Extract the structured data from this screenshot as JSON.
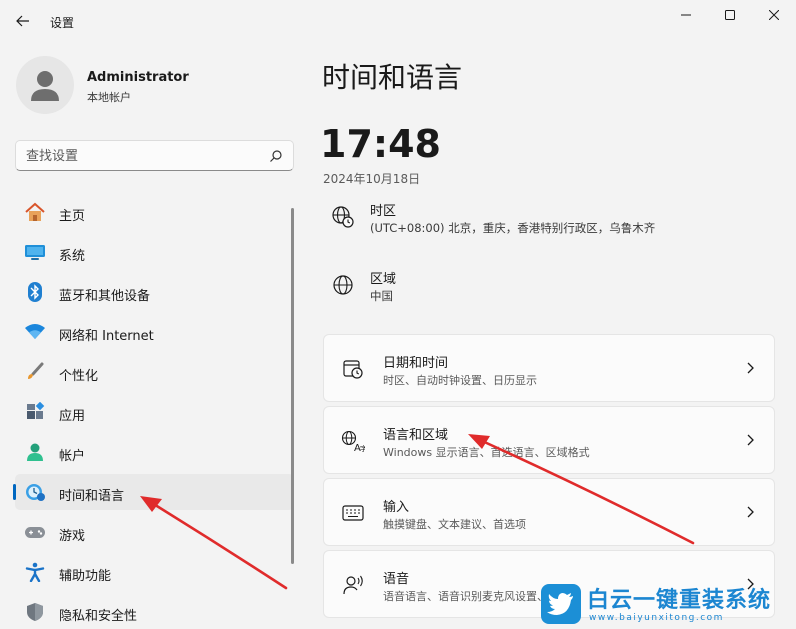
{
  "window": {
    "title": "设置"
  },
  "user": {
    "name": "Administrator",
    "account_type": "本地帐户"
  },
  "search": {
    "placeholder": "查找设置"
  },
  "nav": {
    "items": [
      {
        "label": "主页",
        "icon": "home-icon"
      },
      {
        "label": "系统",
        "icon": "system-icon"
      },
      {
        "label": "蓝牙和其他设备",
        "icon": "bluetooth-icon"
      },
      {
        "label": "网络和 Internet",
        "icon": "wifi-icon"
      },
      {
        "label": "个性化",
        "icon": "brush-icon"
      },
      {
        "label": "应用",
        "icon": "apps-icon"
      },
      {
        "label": "帐户",
        "icon": "account-icon"
      },
      {
        "label": "时间和语言",
        "icon": "time-language-icon",
        "active": true
      },
      {
        "label": "游戏",
        "icon": "gamepad-icon"
      },
      {
        "label": "辅助功能",
        "icon": "accessibility-icon"
      },
      {
        "label": "隐私和安全性",
        "icon": "shield-icon"
      }
    ]
  },
  "main": {
    "title": "时间和语言",
    "clock": "17:48",
    "date": "2024年10月18日",
    "timezone": {
      "title": "时区",
      "value": "(UTC+08:00) 北京，重庆，香港特别行政区，乌鲁木齐"
    },
    "region": {
      "title": "区域",
      "value": "中国"
    },
    "cards": [
      {
        "title": "日期和时间",
        "subtitle": "时区、自动时钟设置、日历显示",
        "icon": "calendar-clock-icon"
      },
      {
        "title": "语言和区域",
        "subtitle": "Windows 显示语言、首选语言、区域格式",
        "icon": "language-icon"
      },
      {
        "title": "输入",
        "subtitle": "触摸键盘、文本建议、首选项",
        "icon": "keyboard-icon"
      },
      {
        "title": "语音",
        "subtitle": "语音语言、语音识别麦克风设置、语音",
        "icon": "speech-icon"
      }
    ]
  },
  "watermark": {
    "text": "白云一键重装系统",
    "url": "www.baiyunxitong.com"
  },
  "colors": {
    "accent": "#0067c0",
    "annotation_arrow": "#e02b2b",
    "watermark": "#1c86d1"
  }
}
